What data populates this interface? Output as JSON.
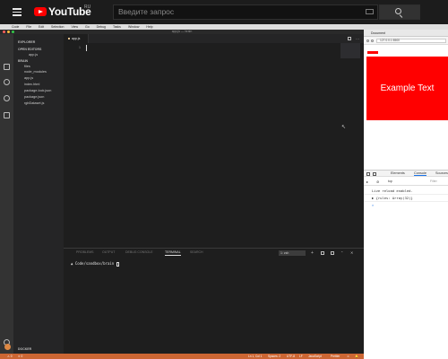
{
  "youtube": {
    "logo_text": "YouTube",
    "region": "RU",
    "search_placeholder": "Введите запрос"
  },
  "mac_menu": [
    "Code",
    "File",
    "Edit",
    "Selection",
    "View",
    "Go",
    "Debug",
    "Tasks",
    "Window",
    "Help"
  ],
  "vscode": {
    "window_title": "app.js — brain",
    "explorer_title": "EXPLORER",
    "open_editors_label": "OPEN EDITORS",
    "open_editor_file": "app.js",
    "project_label": "BRAIN",
    "files": [
      "files",
      "node_modules",
      "app.js",
      "index.html",
      "package-lock.json",
      "package.json",
      "rgbDataset.js"
    ],
    "docker_label": "DOCKER",
    "active_tab": "app.js",
    "line_number": "1",
    "panel_tabs": [
      "PROBLEMS",
      "OUTPUT",
      "DEBUG CONSOLE",
      "TERMINAL",
      "SEARCH"
    ],
    "active_panel_tab": "TERMINAL",
    "terminal_select": "1: zsh",
    "terminal_prompt": "▲ Code/sandbox/brain",
    "status_left": [
      "⚠ 0",
      "✕ 0"
    ],
    "status_right": [
      "Ln 1, Col 1",
      "Spaces: 2",
      "UTF-8",
      "LF",
      "JavaScript",
      "Prettier",
      "☺",
      "🔔"
    ]
  },
  "browser": {
    "tab_title": "Document",
    "address": "127.0.0.1:5500",
    "example_text": "Example Text",
    "devtools_tabs": [
      "Elements",
      "Console",
      "Sources"
    ],
    "active_devtools_tab": "Console",
    "context_select": "top",
    "filter_placeholder": "Filter",
    "console_lines": [
      "Live reload enabled.",
      "▶ {rules: Array(32)}",
      ">"
    ]
  },
  "colors": {
    "status_bar": "#cc6633",
    "example_box": "#ff0000",
    "youtube_red": "#ff0000"
  }
}
